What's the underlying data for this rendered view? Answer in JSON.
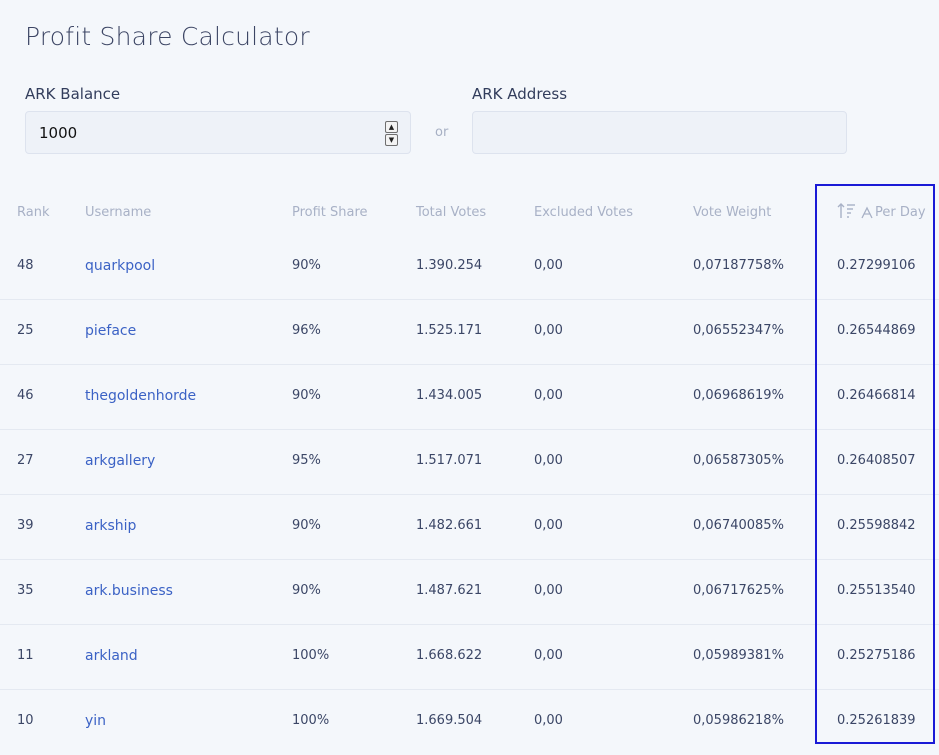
{
  "page": {
    "title": "Profit Share Calculator"
  },
  "form": {
    "balance_label": "ARK Balance",
    "balance_value": "1000",
    "or_label": "or",
    "address_label": "ARK Address",
    "address_value": ""
  },
  "table": {
    "headers": {
      "rank": "Rank",
      "username": "Username",
      "profit_share": "Profit Share",
      "total_votes": "Total Votes",
      "excluded_votes": "Excluded Votes",
      "vote_weight": "Vote Weight",
      "per_day": "Per Day",
      "per_day_icon": "sort-ascending-icon",
      "per_day_currency_icon": "ark-currency-icon"
    },
    "rows": [
      {
        "rank": "48",
        "username": "quarkpool",
        "profit_share": "90%",
        "total_votes": "1.390.254",
        "excluded_votes": "0,00",
        "vote_weight": "0,07187758%",
        "per_day": "0.27299106"
      },
      {
        "rank": "25",
        "username": "pieface",
        "profit_share": "96%",
        "total_votes": "1.525.171",
        "excluded_votes": "0,00",
        "vote_weight": "0,06552347%",
        "per_day": "0.26544869"
      },
      {
        "rank": "46",
        "username": "thegoldenhorde",
        "profit_share": "90%",
        "total_votes": "1.434.005",
        "excluded_votes": "0,00",
        "vote_weight": "0,06968619%",
        "per_day": "0.26466814"
      },
      {
        "rank": "27",
        "username": "arkgallery",
        "profit_share": "95%",
        "total_votes": "1.517.071",
        "excluded_votes": "0,00",
        "vote_weight": "0,06587305%",
        "per_day": "0.26408507"
      },
      {
        "rank": "39",
        "username": "arkship",
        "profit_share": "90%",
        "total_votes": "1.482.661",
        "excluded_votes": "0,00",
        "vote_weight": "0,06740085%",
        "per_day": "0.25598842"
      },
      {
        "rank": "35",
        "username": "ark.business",
        "profit_share": "90%",
        "total_votes": "1.487.621",
        "excluded_votes": "0,00",
        "vote_weight": "0,06717625%",
        "per_day": "0.25513540"
      },
      {
        "rank": "11",
        "username": "arkland",
        "profit_share": "100%",
        "total_votes": "1.668.622",
        "excluded_votes": "0,00",
        "vote_weight": "0,05989381%",
        "per_day": "0.25275186"
      },
      {
        "rank": "10",
        "username": "yin",
        "profit_share": "100%",
        "total_votes": "1.669.504",
        "excluded_votes": "0,00",
        "vote_weight": "0,05986218%",
        "per_day": "0.25261839"
      }
    ]
  },
  "colors": {
    "background": "#f4f7fb",
    "link": "#3b62c5",
    "header_text": "#a8b1c6",
    "highlight_border": "#1a1ad6"
  }
}
